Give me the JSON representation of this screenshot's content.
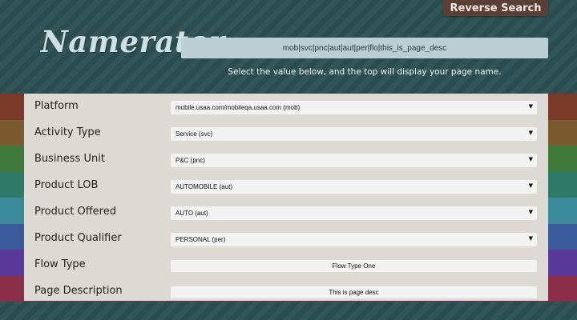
{
  "header": {
    "logo": "Namerator",
    "reverse_search_label": "Reverse Search",
    "page_name_value": "mob|svc|pnc|aut|aut|per|flo|this_is_page_desc",
    "instruction": "Select the value below, and the top will display your page name."
  },
  "form": {
    "fields": [
      {
        "label": "Platform",
        "type": "select",
        "value": "mobile.usaa.com/mobileqa.usaa.com (mob)"
      },
      {
        "label": "Activity Type",
        "type": "select",
        "value": "Service (svc)"
      },
      {
        "label": "Business Unit",
        "type": "select",
        "value": "P&C (pnc)"
      },
      {
        "label": "Product LOB",
        "type": "select",
        "value": "AUTOMOBILE (aut)"
      },
      {
        "label": "Product Offered",
        "type": "select",
        "value": "AUTO (aut)"
      },
      {
        "label": "Product Qualifier",
        "type": "select",
        "value": "PERSONAL (per)"
      },
      {
        "label": "Flow Type",
        "type": "input",
        "value": "Flow Type One"
      },
      {
        "label": "Page Description",
        "type": "input",
        "value": "This is page desc"
      }
    ]
  },
  "icons": {
    "dropdown": "caret-down-icon"
  },
  "colors": {
    "background": "#2c4f52",
    "panel": "#ddd9d4",
    "reverse_button": "#5a3f36",
    "name_box": "#bccfd2",
    "side_stripes": [
      "#7a3a2a",
      "#7a5a2e",
      "#3f7a3a",
      "#2e7a66",
      "#3a8a99",
      "#3a5a99",
      "#5a3a99",
      "#8a2e4a"
    ]
  }
}
